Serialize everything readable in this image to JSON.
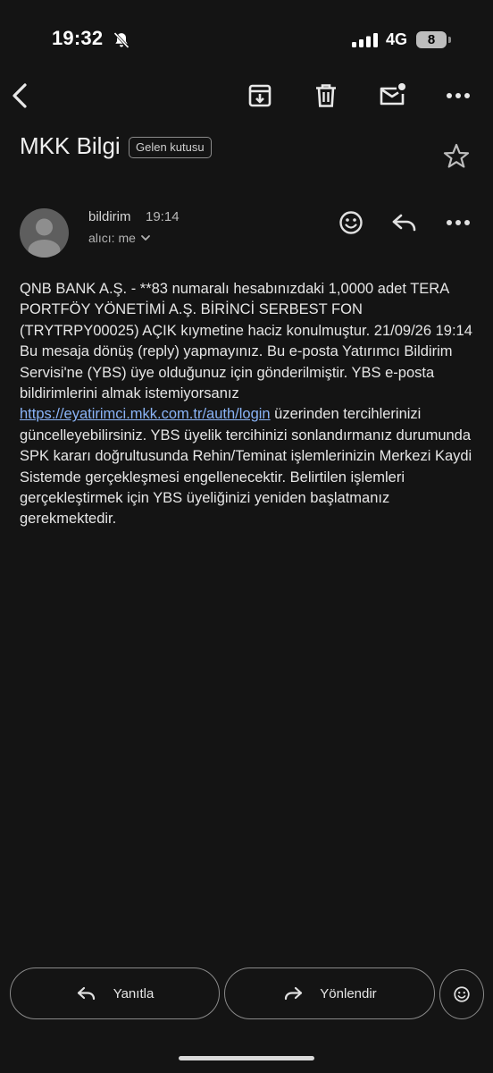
{
  "status_bar": {
    "time": "19:32",
    "network": "4G",
    "battery": "8"
  },
  "toolbar": {
    "back_icon": "arrow-back-icon",
    "archive_icon": "archive-icon",
    "delete_icon": "trash-icon",
    "mark_unread_icon": "mark-unread-icon",
    "more_icon": "more-horiz-icon"
  },
  "email": {
    "subject": "MKK Bilgi",
    "label": "Gelen kutusu",
    "sender": "bildirim",
    "time": "19:14",
    "recipient": "alıcı: me",
    "body_before_link": "QNB BANK A.Ş. - **83 numaralı hesabınızdaki 1,0000 adet TERA PORTFÖY YÖNETİMİ A.Ş. BİRİNCİ SERBEST FON (TRYTRPY00025) AÇIK kıymetine haciz konulmuştur. 21/09/26 19:14 Bu mesaja dönüş (reply) yapmayınız. Bu e-posta Yatırımcı Bildirim Servisi'ne (YBS) üye olduğunuz için gönderilmiştir. YBS e-posta bildirimlerini almak istemiyorsanız ",
    "body_link": "https://eyatirimci.mkk.com.tr/auth/login",
    "body_after_link": " üzerinden tercihlerinizi güncelleyebilirsiniz. YBS üyelik tercihinizi sonlandırmanız durumunda SPK kararı doğrultusunda Rehin/Teminat işlemlerinizin Merkezi Kaydi Sistemde gerçekleşmesi engellenecektir. Belirtilen işlemleri gerçekleştirmek için YBS üyeliğinizi yeniden başlatmanız gerekmektedir."
  },
  "actions": {
    "reply_label": "Yanıtla",
    "forward_label": "Yönlendir"
  },
  "colors": {
    "background": "#141414",
    "link": "#8ab4f8"
  }
}
